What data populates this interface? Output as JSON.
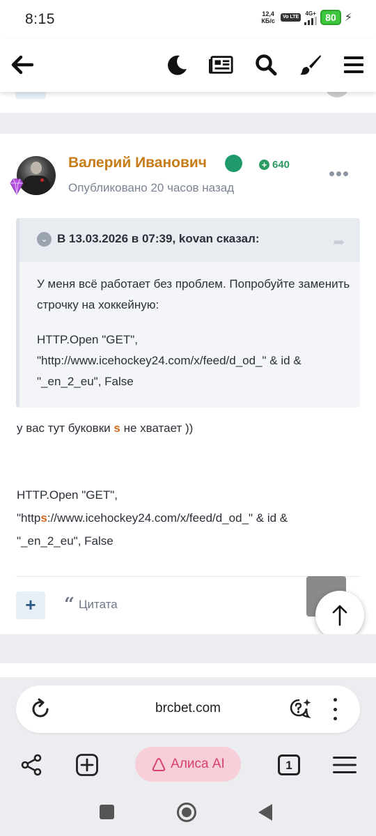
{
  "status_bar": {
    "time": "8:15",
    "net_speed": "12,4",
    "net_unit": "КБ/с",
    "volte": "Vo LTE",
    "network": "4G+",
    "battery": "80"
  },
  "header": {
    "icons": [
      "back-arrow-icon",
      "moon-icon",
      "newspaper-icon",
      "search-icon",
      "brush-icon",
      "hamburger-menu-icon"
    ]
  },
  "post": {
    "author": "Валерий Иванович",
    "reputation": "640",
    "published": "Опубликовано 20 часов назад",
    "quote": {
      "citation": "В 13.03.2026 в 07:39, kovan сказал:",
      "text": "У меня всё работает без проблем. Попробуйте заменить строчку на хоккейную:",
      "code": "HTTP.Open \"GET\", \"http://www.icehockey24.com/x/feed/d_od_\" & id & \"_en_2_eu\", False"
    },
    "body_line1_before": "у вас тут буковки ",
    "body_line1_highlight": "s",
    "body_line1_after": " не хватает ))",
    "body_code_line1": "HTTP.Open \"GET\",",
    "body_code_before": "\"http",
    "body_code_highlight": "s",
    "body_code_after": "://www.icehockey24.com/x/feed/d_od_\" & id & \"_en_2_eu\", False",
    "actions": {
      "add": "+",
      "quote": "Цитата"
    }
  },
  "browser": {
    "url": "brcbet.com",
    "alice_label": "Алиса AI",
    "tab_count": "1"
  },
  "colors": {
    "author": "#c77c18",
    "online": "#1f9a6b",
    "reputation": "#2b9a63",
    "highlight": "#d2691e",
    "alice_bg": "#f6cfd8"
  }
}
